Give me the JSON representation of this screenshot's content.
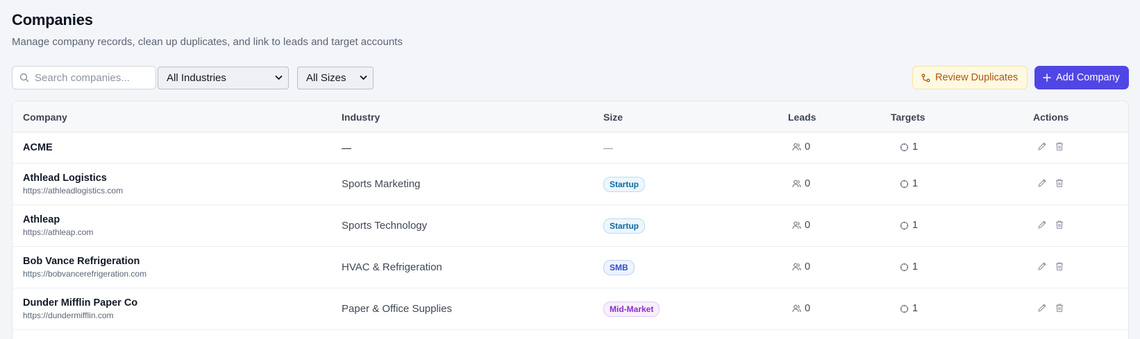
{
  "page": {
    "title": "Companies",
    "subtitle": "Manage company records, clean up duplicates, and link to leads and target accounts"
  },
  "toolbar": {
    "search_placeholder": "Search companies...",
    "industry_filter": "All Industries",
    "size_filter": "All Sizes",
    "review_duplicates_label": "Review Duplicates",
    "add_company_label": "Add Company"
  },
  "table": {
    "columns": {
      "company": "Company",
      "industry": "Industry",
      "size": "Size",
      "leads": "Leads",
      "targets": "Targets",
      "actions": "Actions"
    },
    "rows": [
      {
        "name": "ACME",
        "url": "",
        "industry": "—",
        "size": "—",
        "leads": "0",
        "targets": "1"
      },
      {
        "name": "Athlead Logistics",
        "url": "https://athleadlogistics.com",
        "industry": "Sports Marketing",
        "size": "Startup",
        "leads": "0",
        "targets": "1"
      },
      {
        "name": "Athleap",
        "url": "https://athleap.com",
        "industry": "Sports Technology",
        "size": "Startup",
        "leads": "0",
        "targets": "1"
      },
      {
        "name": "Bob Vance Refrigeration",
        "url": "https://bobvancerefrigeration.com",
        "industry": "HVAC & Refrigeration",
        "size": "SMB",
        "leads": "0",
        "targets": "1"
      },
      {
        "name": "Dunder Mifflin Paper Co",
        "url": "https://dundermifflin.com",
        "industry": "Paper & Office Supplies",
        "size": "Mid-Market",
        "leads": "0",
        "targets": "1"
      }
    ]
  },
  "colors": {
    "primary": "#4f46e5",
    "duplicates_bg": "#fef9e1",
    "duplicates_text": "#b0560f"
  }
}
